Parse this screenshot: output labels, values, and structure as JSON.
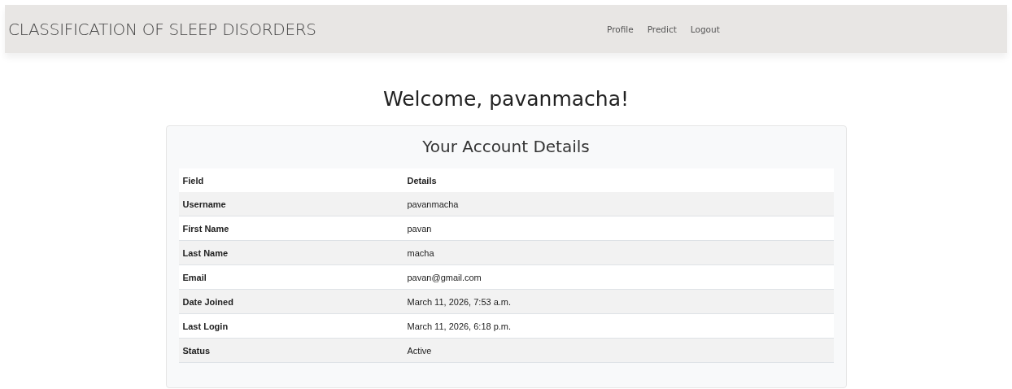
{
  "navbar": {
    "brand": "CLASSIFICATION OF SLEEP DISORDERS",
    "links": [
      "Profile",
      "Predict",
      "Logout"
    ]
  },
  "heading": "Welcome, pavanmacha!",
  "card": {
    "title": "Your Account Details",
    "table": {
      "columns": [
        "Field",
        "Details"
      ],
      "rows": [
        [
          "Username",
          "pavanmacha"
        ],
        [
          "First Name",
          "pavan"
        ],
        [
          "Last Name",
          "macha"
        ],
        [
          "Email",
          "pavan@gmail.com"
        ],
        [
          "Date Joined",
          "March 11, 2026, 7:53 a.m."
        ],
        [
          "Last Login",
          "March 11, 2026, 6:18 p.m."
        ],
        [
          "Status",
          "Active"
        ]
      ]
    }
  }
}
